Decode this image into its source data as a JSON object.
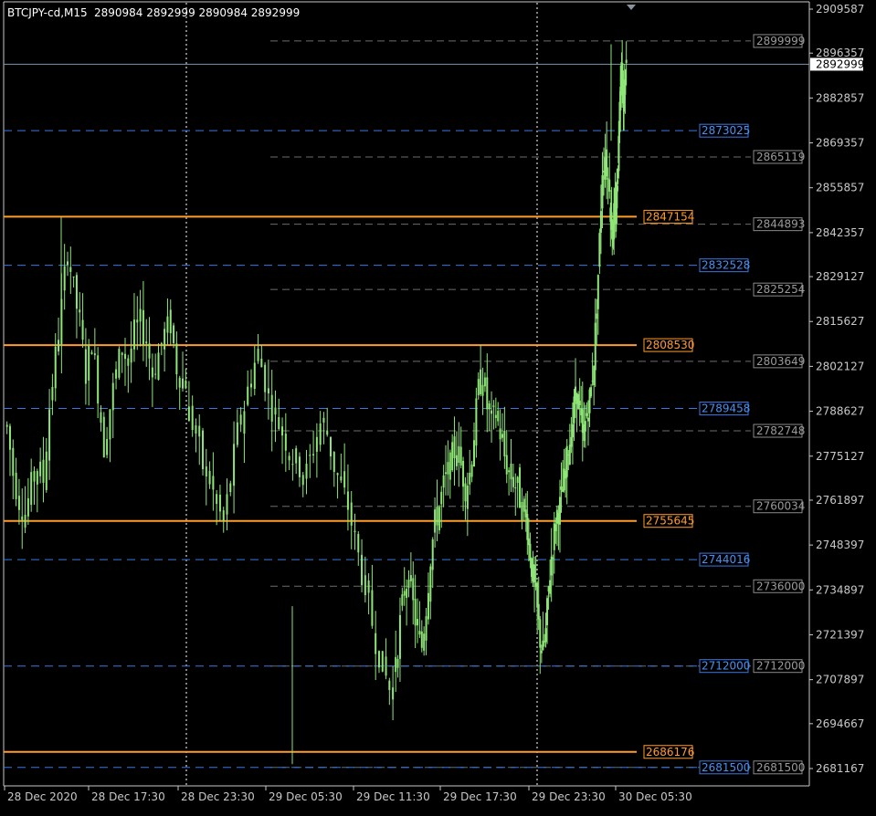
{
  "header": {
    "symbol": "BTCJPY-cd,M15",
    "ohlc": "2890984 2892999 2890984 2892999"
  },
  "colors": {
    "background": "#000000",
    "candle": "#8ee676",
    "axis": "#c8c8c8",
    "grid_dotted": "#ffffff",
    "orange_line": "#ff9c2a",
    "blue_dash": "#3a78e0",
    "gray_dash": "#6c6c6c",
    "price_line": "#7c96b4",
    "current_label_bg": "#ffffff"
  },
  "chart_data": {
    "type": "candlestick",
    "title": "BTCJPY-cd,M15",
    "ylim": [
      2675000,
      2912000
    ],
    "y_ticks": [
      2909587,
      2896357,
      2882857,
      2869357,
      2855857,
      2842357,
      2829127,
      2815627,
      2802127,
      2788627,
      2775127,
      2761897,
      2748397,
      2734897,
      2721397,
      2707897,
      2694667,
      2681167
    ],
    "x_ticks": [
      "28 Dec 2020",
      "28 Dec 17:30",
      "28 Dec 23:30",
      "29 Dec 05:30",
      "29 Dec 11:30",
      "29 Dec 17:30",
      "29 Dec 23:30",
      "30 Dec 05:30"
    ],
    "vertical_separators": [
      "28 Dec 17:30",
      "29 Dec 05:30",
      "29 Dec 23:30"
    ],
    "current_price": 2892999,
    "orange_levels": [
      2847154,
      2808530,
      2755645,
      2686176
    ],
    "blue_levels": [
      2873025,
      2832528,
      2789458,
      2744016,
      2712000,
      2681500
    ],
    "gray_levels": [
      2899999,
      2865119,
      2844893,
      2825254,
      2803649,
      2782748,
      2760034,
      2736000,
      2712000,
      2681500
    ],
    "close_path": [
      [
        2784000,
        2770000,
        2762000,
        2758000,
        2766000,
        2772000,
        2768000,
        2790000,
        2805000,
        2820000,
        2838000,
        2825000,
        2815000,
        2800000,
        2810000,
        2795000,
        2778000,
        2790000,
        2800000,
        2808000,
        2803000,
        2812000,
        2815000,
        2810000,
        2800000,
        2806000,
        2812000,
        2815000,
        2802000,
        2798000
      ],
      [
        2788000,
        2782000,
        2772000,
        2768000,
        2760000,
        2755000,
        2768000,
        2782000,
        2790000,
        2800000,
        2806000,
        2798000,
        2790000,
        2785000,
        2780000,
        2775000,
        2772000,
        2770000,
        2778000,
        2785000,
        2782000,
        2772000,
        2766000,
        2760000,
        2750000,
        2740000,
        2730000,
        2720000,
        2712000,
        2705000
      ],
      [
        2712000,
        2725000,
        2735000,
        2740000,
        2730000,
        2722000,
        2718000,
        2730000,
        2745000,
        2755000,
        2760000,
        2766000,
        2770000,
        2775000,
        2778000,
        2772000,
        2766000,
        2770000,
        2782000,
        2795000,
        2800000,
        2790000,
        2785000,
        2788000,
        2782000,
        2775000,
        2770000,
        2768000,
        2765000,
        2760000
      ],
      [
        2758000,
        2750000,
        2742000,
        2735000,
        2728000,
        2720000,
        2716000,
        2722000,
        2735000,
        2745000,
        2752000,
        2758000,
        2760000,
        2765000,
        2770000,
        2778000,
        2782000,
        2790000,
        2795000,
        2788000,
        2780000,
        2785000,
        2790000,
        2795000,
        2805000,
        2820000,
        2840000,
        2862000,
        2866000,
        2858000
      ],
      [
        2850000,
        2846000,
        2842000,
        2848000,
        2845000,
        2850000,
        2860000,
        2870000,
        2885000,
        2893000,
        2888000,
        2880000,
        2885000,
        2892999
      ]
    ]
  }
}
